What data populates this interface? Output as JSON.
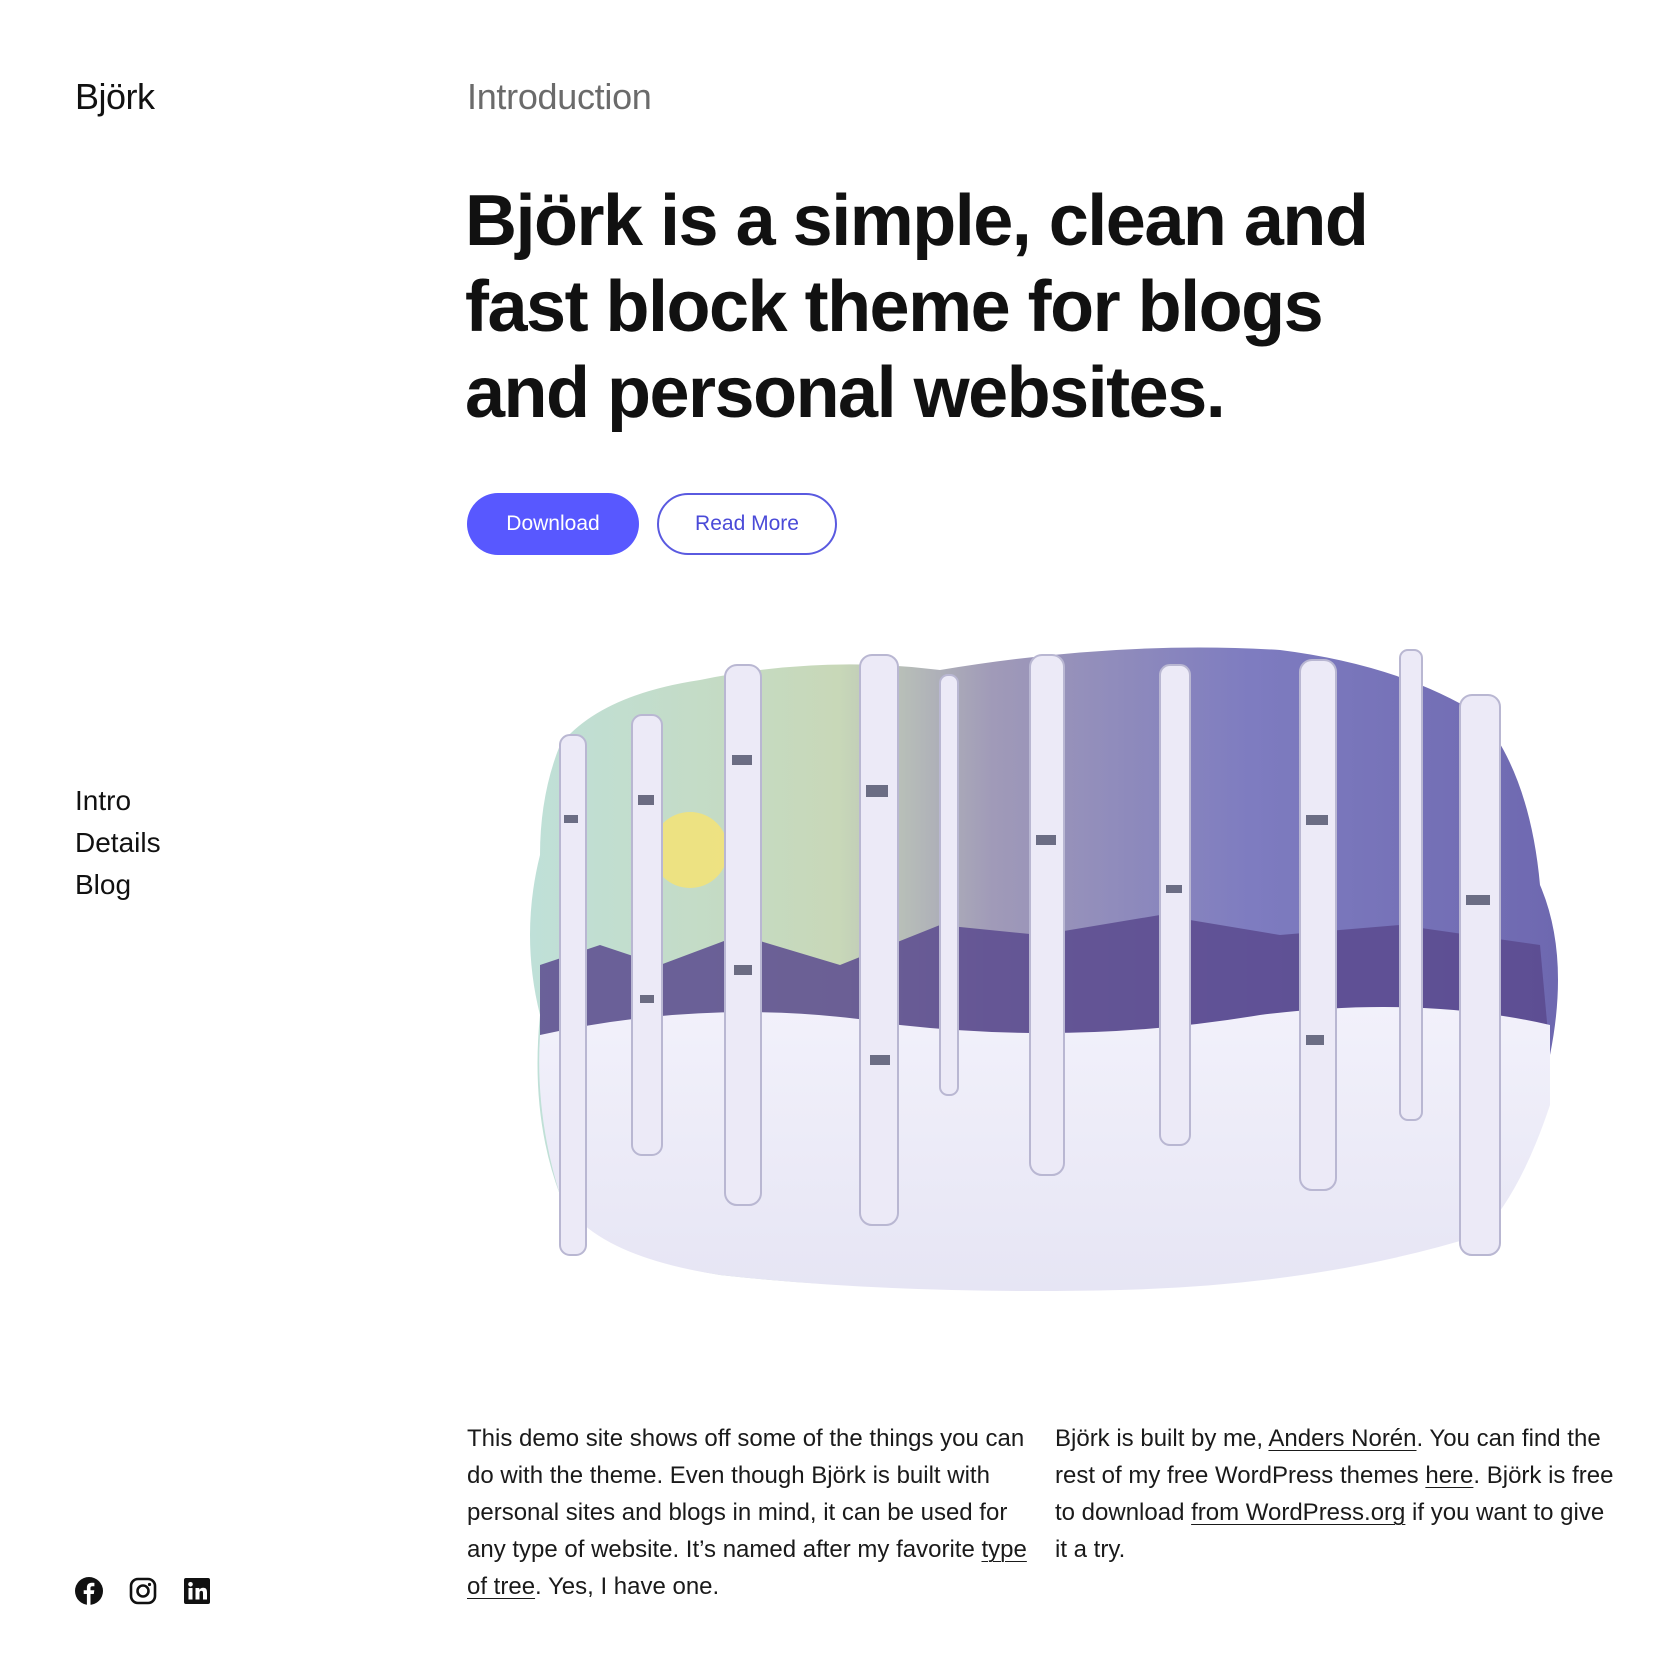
{
  "site": {
    "title": "Björk"
  },
  "section": {
    "label": "Introduction"
  },
  "hero": {
    "heading": "Björk is a simple, clean and fast block theme for blogs and personal websites.",
    "buttons": {
      "primary": "Download",
      "secondary": "Read More"
    }
  },
  "nav": {
    "items": [
      {
        "label": "Intro"
      },
      {
        "label": "Details"
      },
      {
        "label": "Blog"
      }
    ]
  },
  "illustration": {
    "alt": "Painted winter forest of birch trees with snow and a pale sun"
  },
  "content": {
    "left": {
      "text_before": "This demo site shows off some of the things you can do with the theme. Even though Björk is built with personal sites and blogs in mind, it can be used for any type of website. It’s named after my favorite ",
      "link": "type of tree",
      "text_after": ". Yes, I have one."
    },
    "right": {
      "t1": "Björk is built by me, ",
      "link1": "Anders Norén",
      "t2": ". You can find the rest of my free WordPress themes ",
      "link2": "here",
      "t3": ". Björk is free to download ",
      "link3": "from WordPress.org",
      "t4": " if you want to give it a try."
    }
  },
  "social": {
    "icons": [
      "facebook-icon",
      "instagram-icon",
      "linkedin-icon"
    ]
  },
  "colors": {
    "accent": "#5858ff",
    "text": "#111111",
    "muted": "#6b6b6b"
  }
}
